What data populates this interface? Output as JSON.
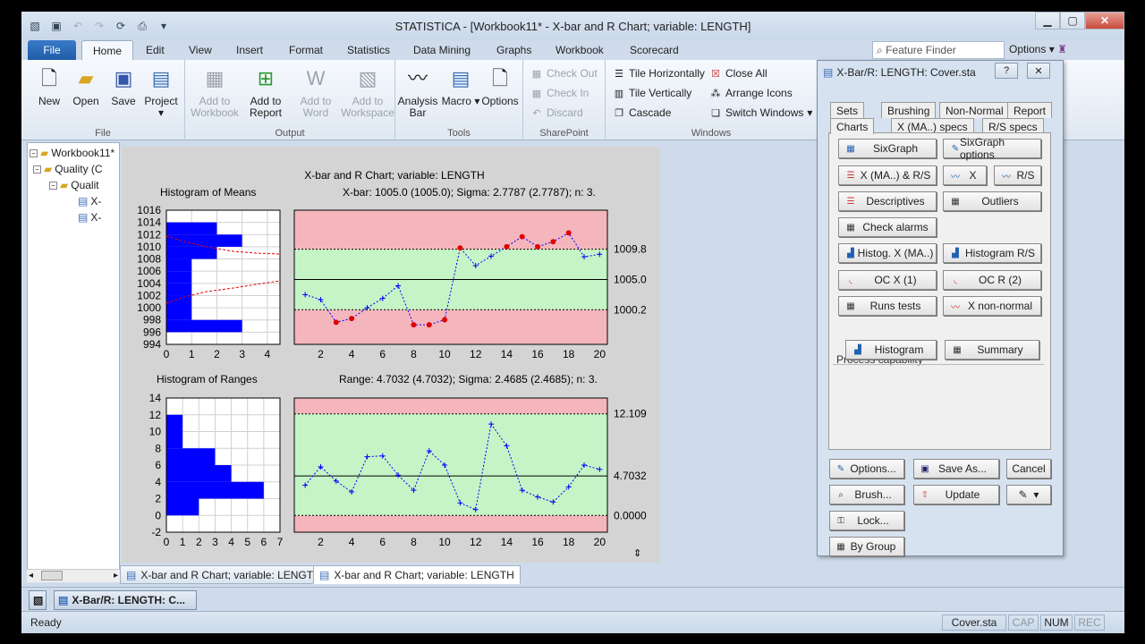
{
  "window": {
    "title": "STATISTICA - [Workbook11* - X-bar and R Chart; variable:  LENGTH]",
    "app_icon": "statistica-app-icon",
    "feature_finder_placeholder": "Feature Finder",
    "options_label": "Options"
  },
  "ribbon": {
    "file_tab": "File",
    "tabs": [
      "Home",
      "Edit",
      "View",
      "Insert",
      "Format",
      "Statistics",
      "Data Mining",
      "Graphs",
      "Workbook",
      "Scorecard"
    ],
    "groups": {
      "file": {
        "label": "File",
        "new": "New",
        "open": "Open",
        "save": "Save",
        "project": "Project"
      },
      "output": {
        "label": "Output",
        "add_to_workbook": "Add to Workbook",
        "add_to_report": "Add to Report",
        "add_to_word": "Add to Word",
        "add_to_workspace": "Add to Workspace"
      },
      "tools": {
        "label": "Tools",
        "analysis_bar": "Analysis Bar",
        "macro": "Macro",
        "options": "Options"
      },
      "sharepoint": {
        "label": "SharePoint",
        "check_out": "Check Out",
        "check_in": "Check In",
        "discard": "Discard"
      },
      "windows": {
        "label": "Windows",
        "tile_h": "Tile Horizontally",
        "tile_v": "Tile Vertically",
        "cascade": "Cascade",
        "close_all": "Close All",
        "arrange_icons": "Arrange Icons",
        "switch_windows": "Switch Windows"
      }
    }
  },
  "tree": {
    "nodes": [
      "Workbook11*",
      "Quality (C",
      "Qualit",
      "X-",
      "X-"
    ]
  },
  "graph": {
    "main_title": "X-bar and R Chart; variable:  LENGTH",
    "hist_means_title": "Histogram of Means",
    "xbar_summary": "X-bar: 1005.0 (1005.0); Sigma: 2.7787 (2.7787); n: 3.",
    "hist_ranges_title": "Histogram of Ranges",
    "range_summary": "Range: 4.7032 (4.7032); Sigma: 2.4685 (2.4685); n: 3.",
    "xbar_limits": {
      "ucl": "1009.8",
      "center": "1005.0",
      "lcl": "1000.2"
    },
    "range_limits": {
      "ucl": "12.109",
      "center": "4.7032",
      "lcl": "0.0000"
    }
  },
  "chart_data": [
    {
      "type": "line",
      "title": "X-bar",
      "x": [
        1,
        2,
        3,
        4,
        5,
        6,
        7,
        8,
        9,
        10,
        11,
        12,
        13,
        14,
        15,
        16,
        17,
        18,
        19,
        20
      ],
      "values": [
        1002.6,
        1001.8,
        998.2,
        998.8,
        1000.5,
        1002.0,
        1004.0,
        997.8,
        997.8,
        998.6,
        1010.0,
        1007.2,
        1008.7,
        1010.2,
        1011.8,
        1010.2,
        1011.0,
        1012.4,
        1008.6,
        1009.0
      ],
      "out_of_control": [
        3,
        4,
        8,
        9,
        10,
        11,
        14,
        15,
        16,
        17,
        18
      ],
      "ylim": [
        994.7,
        1016.0
      ],
      "xticks": [
        2,
        4,
        6,
        8,
        10,
        12,
        14,
        16,
        18,
        20
      ],
      "limits": {
        "ucl": 1009.8,
        "center": 1005.0,
        "lcl": 1000.2
      }
    },
    {
      "type": "line",
      "title": "Range",
      "x": [
        1,
        2,
        3,
        4,
        5,
        6,
        7,
        8,
        9,
        10,
        11,
        12,
        13,
        14,
        15,
        16,
        17,
        18,
        19,
        20
      ],
      "values": [
        3.6,
        5.8,
        4.1,
        2.8,
        7.0,
        7.1,
        4.8,
        3.0,
        7.7,
        6.0,
        1.5,
        0.7,
        10.9,
        8.3,
        3.0,
        2.2,
        1.6,
        3.4,
        6.0,
        5.5
      ],
      "ylim": [
        -2,
        14
      ],
      "xticks": [
        2,
        4,
        6,
        8,
        10,
        12,
        14,
        16,
        18,
        20
      ],
      "limits": {
        "ucl": 12.109,
        "center": 4.7032,
        "lcl": 0.0
      }
    },
    {
      "type": "bar",
      "title": "Histogram of Means",
      "orientation": "horizontal",
      "bins": [
        [
          996,
          998,
          3
        ],
        [
          998,
          1002,
          1
        ],
        [
          1002,
          1004,
          1
        ],
        [
          1004,
          1006,
          1
        ],
        [
          1006,
          1008,
          1
        ],
        [
          1008,
          1010,
          2
        ],
        [
          1010,
          1012,
          3
        ],
        [
          1012,
          1014,
          2
        ]
      ],
      "ylim": [
        994,
        1016
      ],
      "yticks": [
        994,
        996,
        998,
        1000,
        1002,
        1004,
        1006,
        1008,
        1010,
        1012,
        1014,
        1016
      ],
      "xlim": [
        0,
        4.5
      ],
      "xticks": [
        0,
        1,
        2,
        3,
        4
      ]
    },
    {
      "type": "bar",
      "title": "Histogram of Ranges",
      "orientation": "horizontal",
      "bins": [
        [
          0,
          2,
          2
        ],
        [
          2,
          4,
          6
        ],
        [
          4,
          6,
          4
        ],
        [
          6,
          8,
          3
        ],
        [
          8,
          12,
          1
        ]
      ],
      "ylim": [
        -2,
        14
      ],
      "yticks": [
        -2,
        0,
        2,
        4,
        6,
        8,
        10,
        12,
        14
      ],
      "xlim": [
        0,
        7
      ],
      "xticks": [
        0,
        1,
        2,
        3,
        4,
        5,
        6,
        7
      ]
    }
  ],
  "doc_tabs": [
    "X-bar and R Chart; variable:  LENGTH",
    "X-bar and R Chart; variable:  LENGTH"
  ],
  "taskbar": {
    "item": "X-Bar/R: LENGTH: C..."
  },
  "status": {
    "ready": "Ready",
    "file": "Cover.sta",
    "cap": "CAP",
    "num": "NUM",
    "rec": "REC"
  },
  "dialog": {
    "title": "X-Bar/R: LENGTH: Cover.sta",
    "help": "?",
    "tabs_row1": [
      "Sets",
      "Brushing",
      "Non-Normal",
      "Report"
    ],
    "tabs_row2": [
      "Charts",
      "X (MA..) specs",
      "R/S specs"
    ],
    "buttons": {
      "sixgraph": "SixGraph",
      "sixgraph_options": "SixGraph options",
      "x_ma_rs": "X (MA..) & R/S",
      "x": "X",
      "rs": "R/S",
      "descriptives": "Descriptives",
      "outliers": "Outliers",
      "check_alarms": "Check alarms",
      "histog_x": "Histog. X (MA..)",
      "histogram_rs": "Histogram R/S",
      "oc_x": "OC X (1)",
      "oc_r": "OC R (2)",
      "runs_tests": "Runs tests",
      "x_non_normal": "X non-normal",
      "histogram": "Histogram",
      "summary": "Summary"
    },
    "process_capability": "Process capability",
    "footer": {
      "options": "Options...",
      "save_as": "Save As...",
      "cancel": "Cancel",
      "brush": "Brush...",
      "update": "Update",
      "lock": "Lock...",
      "by_group": "By Group"
    }
  },
  "colors": {
    "red_zone": "#f4b6bc",
    "green_zone": "#c5f5c6",
    "bar": "#0000ff",
    "series": "#0000ff",
    "alarm": "#e00000"
  }
}
